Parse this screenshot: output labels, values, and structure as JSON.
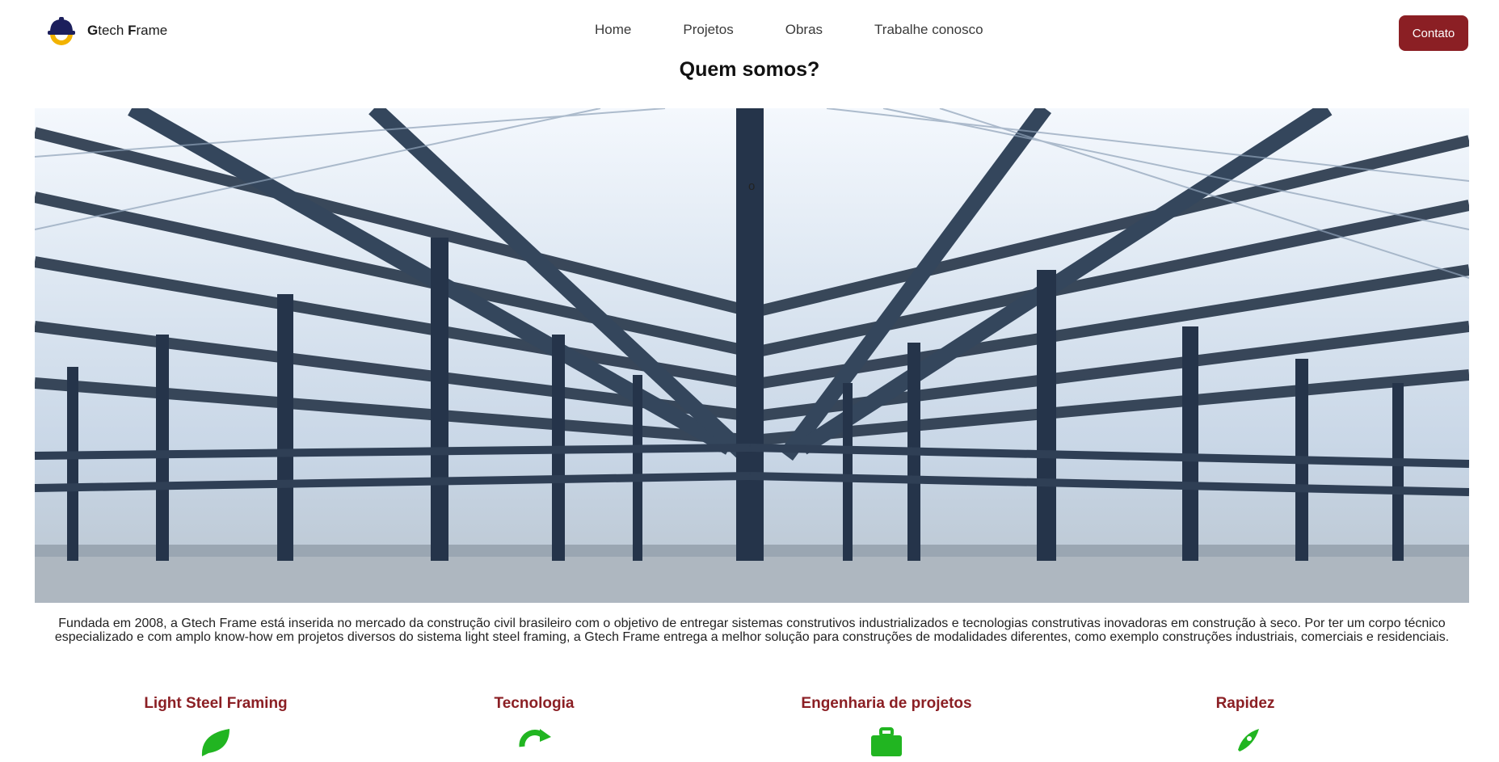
{
  "header": {
    "brand": {
      "first_letter_1": "G",
      "rest_1": "tech ",
      "first_letter_2": "F",
      "rest_2": "rame"
    },
    "logo_icon": "helmet-gear-icon",
    "nav": [
      "Home",
      "Projetos",
      "Obras",
      "Trabalhe conosco"
    ],
    "contact_button": "Contato"
  },
  "main": {
    "title": "Quem somos?",
    "hero_overlay_text": "o",
    "hero_image": "steel-structure-warehouse-photo",
    "description": "Fundada em 2008, a Gtech Frame está inserida no mercado da construção civil brasileiro com o objetivo de entregar sistemas construtivos industrializados e tecnologias construtivas inovadoras em construção à seco. Por ter um corpo técnico especializado e com amplo know-how em projetos diversos do sistema light steel framing, a Gtech Frame entrega a melhor solução para construções de modalidades diferentes, como exemplo construções industriais, comerciais e residenciais."
  },
  "features": [
    {
      "title": "Light Steel Framing",
      "icon": "leaf-icon"
    },
    {
      "title": "Tecnologia",
      "icon": "refresh-icon"
    },
    {
      "title": "Engenharia de projetos",
      "icon": "briefcase-icon"
    },
    {
      "title": "Rapidez",
      "icon": "rocket-icon"
    }
  ],
  "colors": {
    "accent": "#8b1f24",
    "icon_green": "#21b521",
    "logo_navy": "#1c1f5c",
    "logo_gold": "#f2b300"
  }
}
